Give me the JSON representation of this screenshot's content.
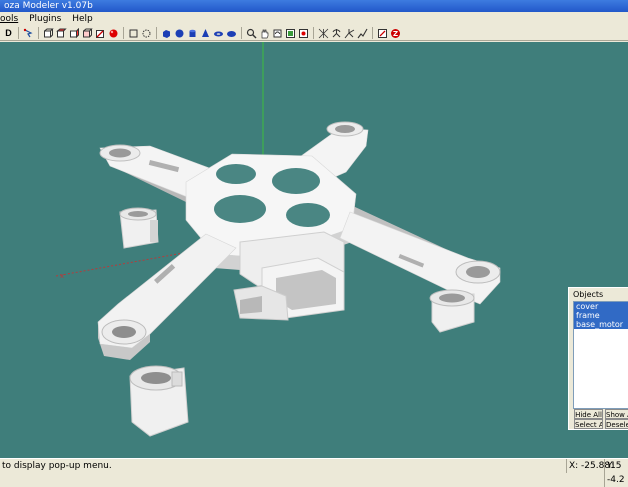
{
  "window": {
    "title": "oza Modeler v1.07b"
  },
  "menu": {
    "items": [
      "ools",
      "Plugins",
      "Help"
    ]
  },
  "toolbar": {
    "first_label": "D"
  },
  "objects_panel": {
    "title": "Objects",
    "items": [
      "cover",
      "frame",
      "base_motor"
    ],
    "hide_all": "Hide All",
    "show_all": "Show A",
    "select_all": "Select All",
    "deselect_all": "Desele"
  },
  "status": {
    "message": "to display pop-up menu.",
    "x": "X: -25.8815",
    "y": "Y: -4.2"
  },
  "colors": {
    "viewport": "#3f7e7b",
    "model": "#f2f2f2",
    "accent": "#316ac5"
  }
}
